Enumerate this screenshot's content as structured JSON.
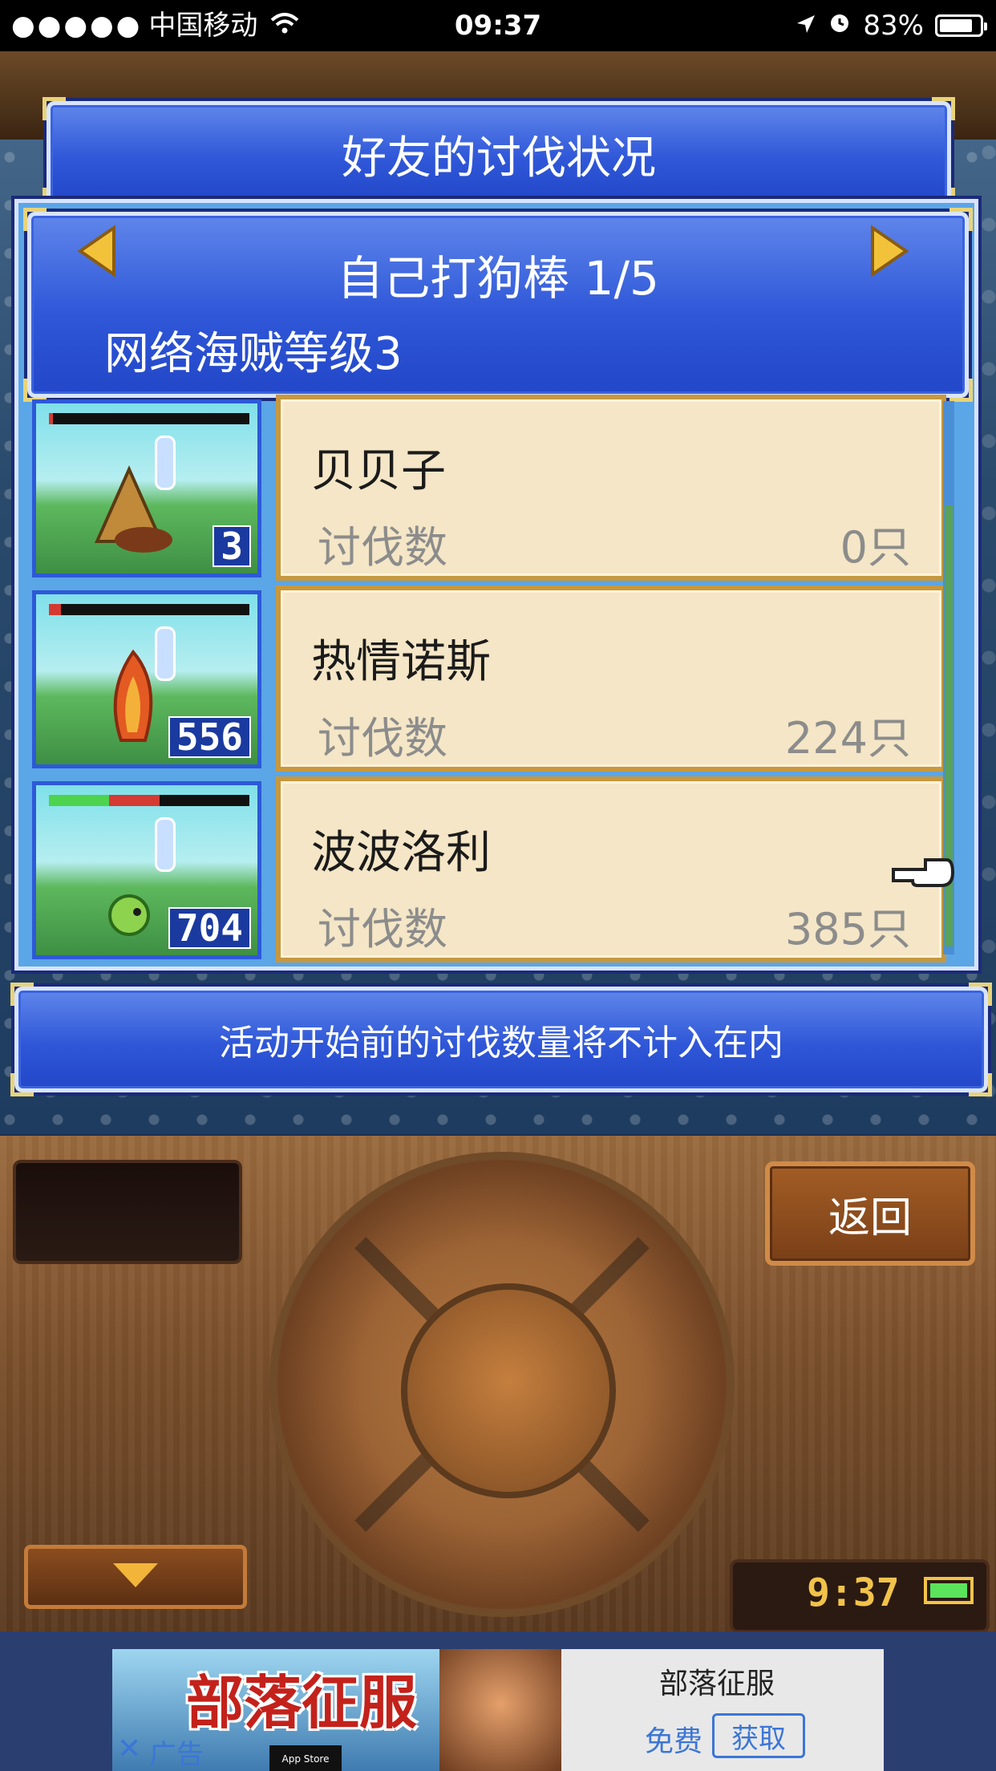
{
  "status_bar": {
    "signal_dots": "●●●●●",
    "carrier": "中国移动",
    "time": "09:37",
    "battery_percent": "83%",
    "battery_level": 0.83
  },
  "dialog": {
    "title": "好友的讨伐状况",
    "quest": {
      "title": "自己打狗棒 1/5",
      "subtitle": "网络海贼等级3"
    },
    "entries": [
      {
        "name": "贝贝子",
        "label": "讨伐数",
        "count": "0只",
        "level": "3",
        "hp_green": 0.0,
        "hp_red": 0.02
      },
      {
        "name": "热情诺斯",
        "label": "讨伐数",
        "count": "224只",
        "level": "556",
        "hp_green": 0.0,
        "hp_red": 0.06
      },
      {
        "name": "波波洛利",
        "label": "讨伐数",
        "count": "385只",
        "level": "704",
        "hp_green": 0.3,
        "hp_red": 0.25
      }
    ],
    "notice": "活动开始前的讨伐数量将不计入在内"
  },
  "controls": {
    "back_label": "返回",
    "clock": "9:37"
  },
  "ad": {
    "logo_text": "部落征服",
    "app_name": "部落征服",
    "free_label": "免费",
    "get_label": "获取",
    "ad_label": "广告",
    "close_glyph": "✕",
    "store_badge": "App Store"
  },
  "colors": {
    "panel_blue": "#2f57d8",
    "card_bg": "#f4e6c6",
    "card_border": "#c7983e",
    "wood": "#7a4f2b",
    "link_blue": "#3b76d6"
  }
}
